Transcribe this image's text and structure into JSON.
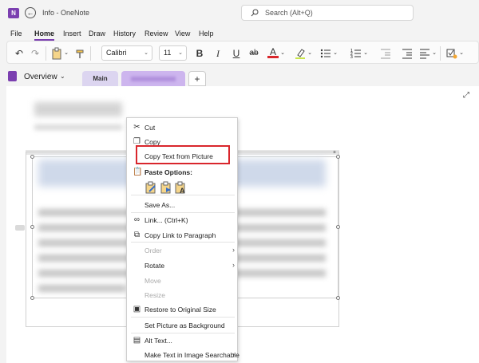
{
  "titlebar": {
    "app_icon": "onenote-icon",
    "app_icon_letter": "N",
    "back_symbol": "←",
    "title": "Info - OneNote",
    "search_placeholder": "Search (Alt+Q)"
  },
  "menu": {
    "tabs": [
      "File",
      "Home",
      "Insert",
      "Draw",
      "History",
      "Review",
      "View",
      "Help"
    ],
    "active": "Home"
  },
  "ribbon": {
    "undo": "↶",
    "redo": "↷",
    "font_name": "Calibri",
    "font_size": "11",
    "bold": "B",
    "italic": "I",
    "underline": "U",
    "strike": "ab",
    "font_color": "A",
    "chevron": "⌄"
  },
  "notebook": {
    "title": "Overview",
    "chevron": "⌄",
    "section_main": "Main",
    "add_symbol": "+"
  },
  "context_menu": {
    "cut": "Cut",
    "copy": "Copy",
    "copy_text": "Copy Text from Picture",
    "paste_options": "Paste Options:",
    "save_as": "Save As...",
    "link": "Link...  (Ctrl+K)",
    "copy_link": "Copy Link to Paragraph",
    "order": "Order",
    "rotate": "Rotate",
    "move": "Move",
    "resize": "Resize",
    "restore": "Restore to Original Size",
    "set_background": "Set Picture as Background",
    "alt_text": "Alt Text...",
    "make_searchable": "Make Text in Image Searchable",
    "submenu_arrow": "›"
  },
  "colors": {
    "accent": "#7b3fb0",
    "highlight_border": "#d9262c",
    "section_main_tab": "#dcd5f0",
    "section_second_tab": "#cdb5ee"
  }
}
